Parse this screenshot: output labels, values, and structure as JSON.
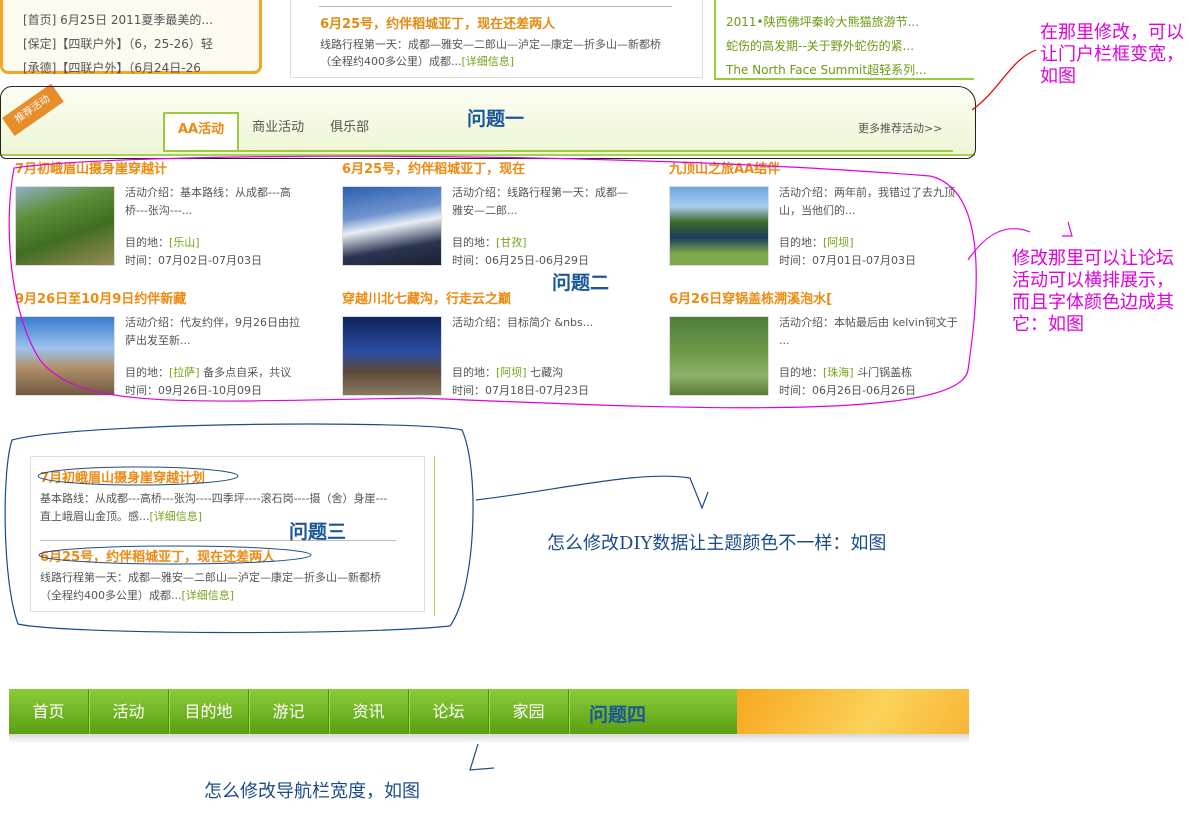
{
  "top": {
    "left_rows": [
      "[首页] 6月25日 2011夏季最美的...",
      "[保定]【四联户外】（6，25-26）轻",
      "[承德]【四联户外】（6月24日-26"
    ],
    "mid_title": "6月25号，约伴稻城亚丁，现在还差两人",
    "mid_desc": "线路行程第一天：成都—雅安—二郎山—泸定—康定—折多山—新都桥（全程约400多公里）成都...",
    "mid_more": "[详细信息]",
    "right_rows": [
      "2011•陕西佛坪秦岭大熊猫旅游节...",
      "蛇伤的高发期--关于野外蛇伤的紧...",
      "The North Face Summit超轻系列..."
    ]
  },
  "rec": {
    "ribbon": "推荐活动",
    "tabs": [
      "AA活动",
      "商业活动",
      "俱乐部"
    ],
    "more": "更多推荐活动>>",
    "q1": "问题一"
  },
  "cards": [
    {
      "title": "7月初峨眉山摄身崖穿越计",
      "intro": "活动介绍：基本路线：从成都---高桥---张沟---...",
      "dest_label": "目的地：",
      "dest": "[乐山]",
      "dest_extra": "",
      "time": "时间：07月02日-07月03日"
    },
    {
      "title": "6月25号，约伴稻城亚丁，现在",
      "intro": "活动介绍：线路行程第一天：成都—雅安—二郎...",
      "dest_label": "目的地：",
      "dest": "[甘孜]",
      "dest_extra": "",
      "time": "时间：06月25日-06月29日"
    },
    {
      "title": "九顶山之旅AA结伴",
      "intro": "活动介绍：两年前，我错过了去九顶山，当他们的...",
      "dest_label": "目的地：",
      "dest": "[阿坝]",
      "dest_extra": "",
      "time": "时间：07月01日-07月03日"
    },
    {
      "title": "9月26日至10月9日约伴新藏",
      "intro": "活动介绍：代友约伴，9月26日由拉萨出发至新...",
      "dest_label": "目的地：",
      "dest": "[拉萨]",
      "dest_extra": " 备多点自采，共议",
      "time": "时间：09月26日-10月09日"
    },
    {
      "title": "穿越川北七藏沟，行走云之巅",
      "intro": "活动介绍：目标简介 &nbs...",
      "dest_label": "目的地：",
      "dest": "[阿坝]",
      "dest_extra": " 七藏沟",
      "time": "时间：07月18日-07月23日"
    },
    {
      "title": "6月26日穿锅盖栋溯溪泡水[",
      "intro": "活动介绍：本帖最后由 kelvin钶文于 ...",
      "dest_label": "目的地：",
      "dest": "[珠海]",
      "dest_extra": " 斗门锅盖栋",
      "time": "时间：06月26日-06月26日"
    }
  ],
  "q2": "问题二",
  "diy": {
    "items": [
      {
        "title": "7月初峨眉山摄身崖穿越计划",
        "desc": "基本路线：从成都---高桥---张沟----四季坪----滚石岗----摄（舍）身崖---直上峨眉山金顶。感...",
        "more": "[详细信息]"
      },
      {
        "title": "6月25号，约伴稻城亚丁，现在还差两人",
        "desc": "线路行程第一天：成都—雅安—二郎山—泸定—康定—折多山—新都桥（全程约400多公里）成都...",
        "more": "[详细信息]"
      }
    ],
    "q3": "问题三"
  },
  "nav": {
    "items": [
      "首页",
      "活动",
      "目的地",
      "游记",
      "资讯",
      "论坛",
      "家园"
    ],
    "q4": "问题四"
  },
  "notes": {
    "n1": "在那里修改，可以让门户栏框变宽，如图",
    "n2": "修改那里可以让论坛活动可以横排展示，而且字体颜色边成其它：如图",
    "n3": "怎么修改DIY数据让主题颜色不一样：如图",
    "n4": "怎么修改导航栏宽度，如图"
  },
  "colors": {
    "accent_orange": "#ee8a12",
    "link_green": "#7aa21b",
    "annotation_magenta": "#e000e0",
    "annotation_blue": "#1a4c8c"
  }
}
